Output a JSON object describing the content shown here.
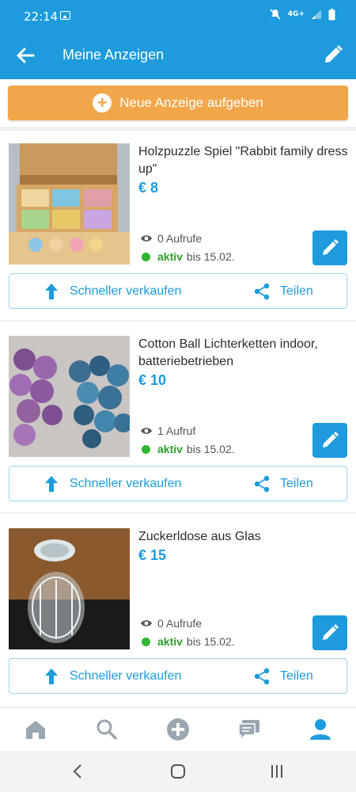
{
  "status_bar": {
    "time": "22:14",
    "network": "4G+"
  },
  "app_bar": {
    "title": "Meine Anzeigen"
  },
  "new_ad_button": {
    "label": "Neue Anzeige aufgeben"
  },
  "listings": [
    {
      "title": "Holzpuzzle Spiel \"Rabbit family dress up\"",
      "price": "€ 8",
      "views": "0 Aufrufe",
      "status": "aktiv",
      "until": "bis 15.02.",
      "sell_label": "Schneller verkaufen",
      "share_label": "Teilen"
    },
    {
      "title": "Cotton Ball Lichterketten indoor, batteriebetrieben",
      "price": "€ 10",
      "views": "1 Aufruf",
      "status": "aktiv",
      "until": "bis 15.02.",
      "sell_label": "Schneller verkaufen",
      "share_label": "Teilen"
    },
    {
      "title": "Zuckerldose aus Glas",
      "price": "€ 15",
      "views": "0 Aufrufe",
      "status": "aktiv",
      "until": "bis 15.02.",
      "sell_label": "Schneller verkaufen",
      "share_label": "Teilen"
    }
  ],
  "bottom_tabs": [
    {
      "icon": "home-icon",
      "active": false
    },
    {
      "icon": "search-icon",
      "active": false
    },
    {
      "icon": "add-circle-icon",
      "active": false
    },
    {
      "icon": "messages-icon",
      "active": false
    },
    {
      "icon": "profile-icon",
      "active": true
    }
  ],
  "colors": {
    "primary": "#1d9bdc",
    "accent": "#f2a64a",
    "active_green": "#2aa12a",
    "inactive_icon": "#9aa7b1"
  }
}
